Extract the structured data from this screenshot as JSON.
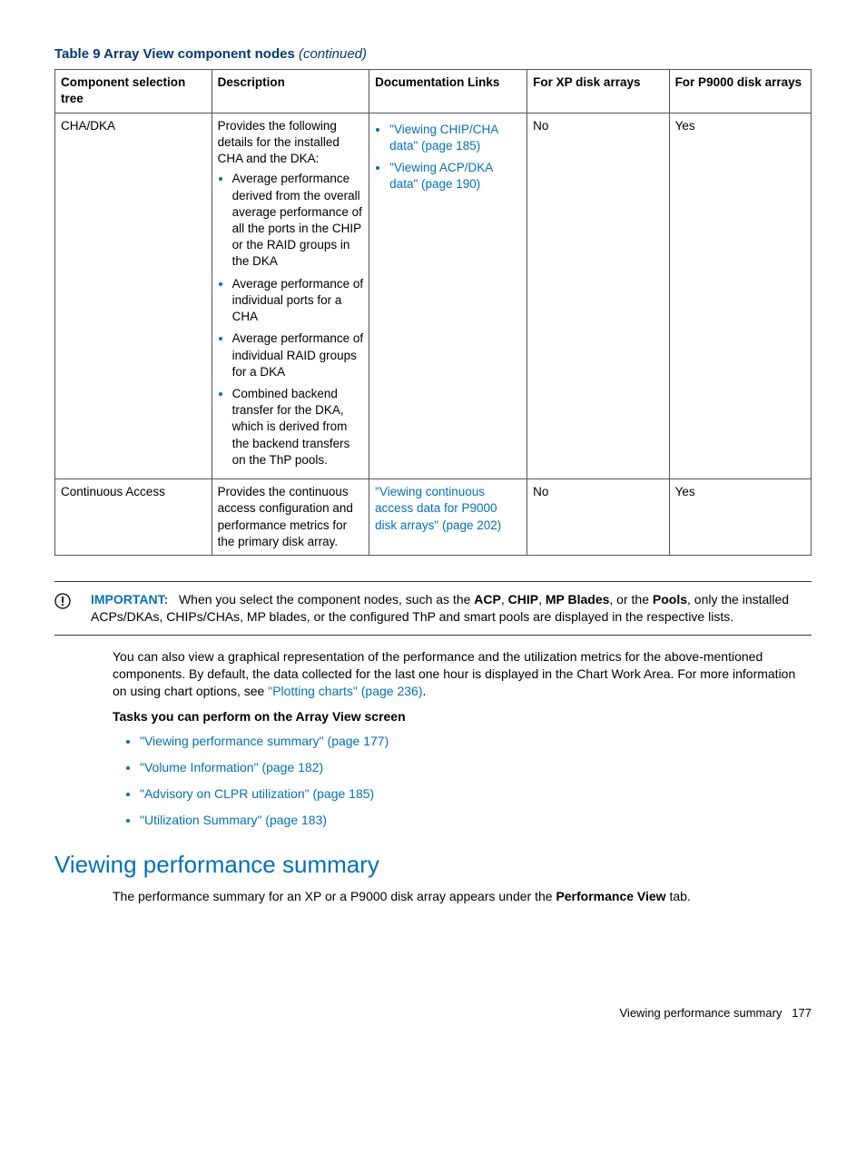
{
  "table": {
    "caption_prefix": "Table 9 Array View component nodes ",
    "caption_suffix": "(continued)",
    "headers": {
      "c1": "Component selection tree",
      "c2": "Description",
      "c3": "Documentation Links",
      "c4": "For XP disk arrays",
      "c5": "For P9000 disk arrays"
    },
    "rows": [
      {
        "component": "CHA/DKA",
        "desc_intro": "Provides the following details for the installed CHA and the DKA:",
        "desc_items": [
          "Average performance derived from the overall average performance of all the ports in the CHIP or the RAID groups in the DKA",
          "Average performance of individual ports for a CHA",
          "Average performance of individual RAID groups for a DKA",
          "Combined backend transfer for the DKA, which is derived from the backend transfers on the ThP pools."
        ],
        "links": [
          "\"Viewing CHIP/CHA data\" (page 185)",
          "\"Viewing ACP/DKA data\" (page 190)"
        ],
        "xp": "No",
        "p9000": "Yes"
      },
      {
        "component": "Continuous Access",
        "desc_intro": "Provides the continuous access configuration and performance metrics for the primary disk array.",
        "desc_items": [],
        "links_single": "\"Viewing continuous access data for P9000 disk arrays\" (page 202)",
        "xp": "No",
        "p9000": "Yes"
      }
    ]
  },
  "important": {
    "label": "IMPORTANT:",
    "text_before": "When you select the component nodes, such as the ",
    "bold1": "ACP",
    "sep1": ", ",
    "bold2": "CHIP",
    "sep2": ", ",
    "bold3": "MP Blades",
    "sep3": ", or the ",
    "bold4": "Pools",
    "text_after": ", only the installed ACPs/DKAs, CHIPs/CHAs, MP blades, or the configured ThP and smart pools are displayed in the respective lists."
  },
  "body": {
    "para1_before": "You can also view a graphical representation of the performance and the utilization metrics for the above-mentioned components. By default, the data collected for the last one hour is displayed in the Chart Work Area. For more information on using chart options, see ",
    "para1_link": "\"Plotting charts\" (page 236)",
    "para1_after": ".",
    "tasks_heading": "Tasks you can perform on the Array View screen",
    "tasks": [
      "\"Viewing performance summary\" (page 177)",
      "\"Volume Information\" (page 182)",
      "\"Advisory on CLPR utilization\" (page 185)",
      "\"Utilization Summary\" (page 183)"
    ]
  },
  "section": {
    "heading": "Viewing performance summary",
    "para_before": "The performance summary for an XP or a P9000 disk array appears under the ",
    "para_bold": "Performance View",
    "para_after": " tab."
  },
  "footer": {
    "text": "Viewing performance summary",
    "page": "177"
  }
}
